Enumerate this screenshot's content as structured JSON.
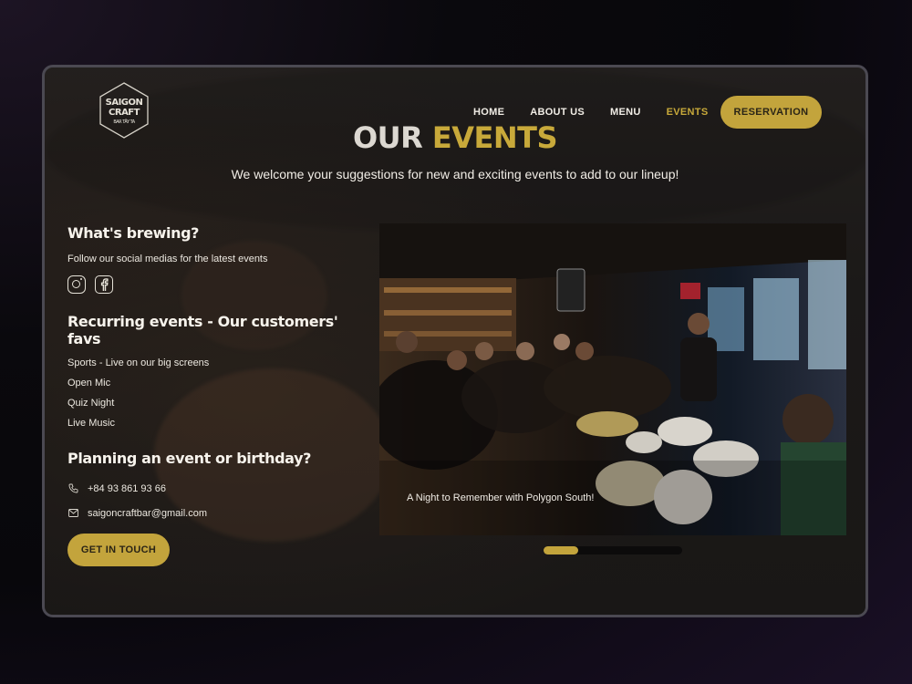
{
  "logo": {
    "line1": "SAIGON",
    "line2": "CRAFT",
    "line3": "BAR TÂY TA"
  },
  "nav": {
    "items": [
      "HOME",
      "ABOUT US",
      "MENU",
      "EVENTS"
    ],
    "active": "EVENTS",
    "reservation_label": "RESERVATION"
  },
  "hero": {
    "title_part1": "OUR",
    "title_part2": "EVENTS",
    "subtitle": "We welcome your suggestions for new and exciting events to add to our lineup!"
  },
  "brewing": {
    "heading": "What's brewing?",
    "text": "Follow our social medias for the latest events",
    "social_icons": [
      "instagram-icon",
      "facebook-icon"
    ]
  },
  "recurring": {
    "heading": "Recurring events - Our customers' favs",
    "items": [
      "Sports - Live on our big screens",
      "Open Mic",
      "Quiz Night",
      "Live Music"
    ]
  },
  "planning": {
    "heading": "Planning an event or birthday?",
    "phone": "+84 93 861 93 66",
    "email": "saigoncraftbar@gmail.com",
    "cta_label": "GET IN TOUCH"
  },
  "carousel": {
    "caption": "A Night to Remember with Polygon South!",
    "progress": 0.25
  },
  "colors": {
    "accent": "#c3a43c",
    "text": "#f1ede6",
    "background": "#211f1d"
  }
}
